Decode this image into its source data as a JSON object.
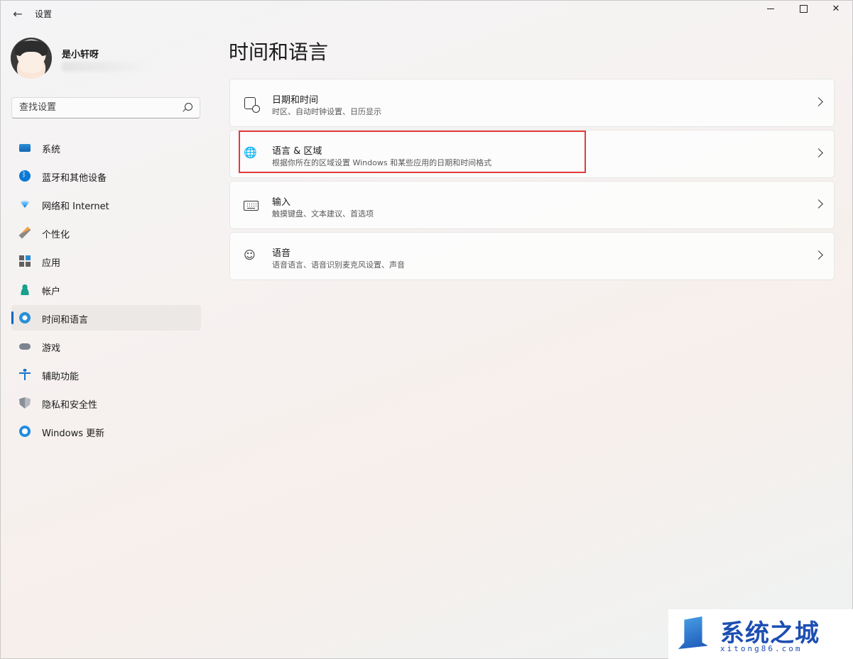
{
  "window": {
    "title": "设置",
    "back_glyph": "←"
  },
  "user": {
    "name": "是小轩呀"
  },
  "search": {
    "placeholder": "查找设置"
  },
  "sidebar": {
    "items": [
      {
        "label": "系统",
        "icon": "system-icon"
      },
      {
        "label": "蓝牙和其他设备",
        "icon": "bluetooth-icon"
      },
      {
        "label": "网络和 Internet",
        "icon": "wifi-icon"
      },
      {
        "label": "个性化",
        "icon": "brush-icon"
      },
      {
        "label": "应用",
        "icon": "apps-icon"
      },
      {
        "label": "帐户",
        "icon": "account-icon"
      },
      {
        "label": "时间和语言",
        "icon": "time-language-icon",
        "active": true
      },
      {
        "label": "游戏",
        "icon": "gamepad-icon"
      },
      {
        "label": "辅助功能",
        "icon": "accessibility-icon"
      },
      {
        "label": "隐私和安全性",
        "icon": "shield-icon"
      },
      {
        "label": "Windows 更新",
        "icon": "update-icon"
      }
    ]
  },
  "main": {
    "title": "时间和语言",
    "cards": [
      {
        "title": "日期和时间",
        "subtitle": "时区、自动时钟设置、日历显示",
        "icon": "calendar-clock-icon"
      },
      {
        "title": "语言 & 区域",
        "subtitle": "根据你所在的区域设置 Windows 和某些应用的日期和时间格式",
        "icon": "language-icon",
        "highlighted": true
      },
      {
        "title": "输入",
        "subtitle": "触摸键盘、文本建议、首选项",
        "icon": "keyboard-icon"
      },
      {
        "title": "语音",
        "subtitle": "语音语言、语音识别麦克风设置、声音",
        "icon": "speech-icon"
      }
    ]
  },
  "watermark": {
    "text": "系统之城",
    "url": "xitong86.com"
  },
  "colors": {
    "accent": "#0067c0",
    "highlight_border": "#e23b3b",
    "watermark": "#1d4fb3"
  }
}
